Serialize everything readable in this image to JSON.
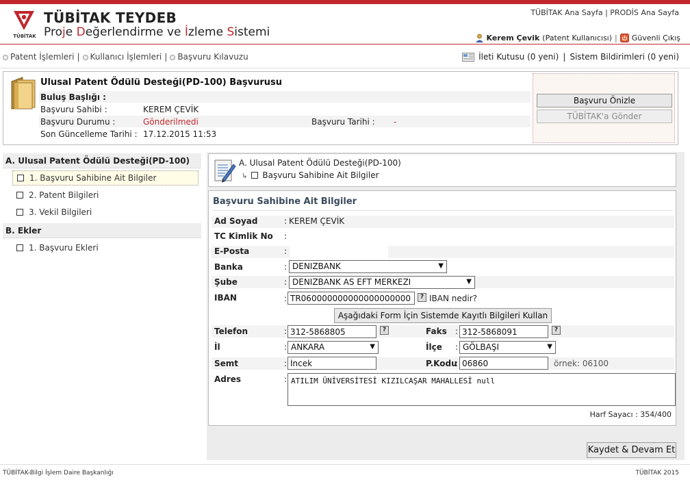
{
  "header": {
    "org_short": "TÜBİTAK",
    "app_name": "TÜBİTAK TEYDEB",
    "app_sub_parts": [
      "Pro",
      "j",
      "e ",
      "D",
      "eğerlendirme ve ",
      "İ",
      "zleme ",
      "S",
      "istemi"
    ],
    "top_link_home": "TÜBİTAK Ana Sayfa",
    "top_link_sep": "|",
    "top_link_prodis": "PRODİS Ana Sayfa",
    "user_name": "Kerem Çevik",
    "user_role": "(Patent Kullanıcısı)",
    "logout": "Güvenli Çıkış",
    "logo_icon": "tubitak-logo-icon",
    "user_icon": "user-icon",
    "logout_icon": "power-icon"
  },
  "nav": {
    "items": [
      "Patent İşlemleri",
      "Kullanıcı İşlemleri",
      "Başvuru Kılavuzu"
    ],
    "sep": "|",
    "inbox": "İleti Kutusu (0 yeni)",
    "system_notices": "Sistem Bildirimleri (0 yeni)"
  },
  "application": {
    "title": "Ulusal Patent Ödülü Desteği(PD-100) Başvurusu",
    "rows": {
      "invention_title_label": "Buluş Başlığı :",
      "invention_title_value": "",
      "owner_label": "Başvuru Sahibi :",
      "owner_value": "KEREM ÇEVİK",
      "status_label": "Başvuru Durumu :",
      "status_value": "Gönderilmedi",
      "date_label": "Başvuru Tarihi :",
      "date_value": "-",
      "updated_label": "Son Güncelleme Tarihi :",
      "updated_value": "17.12.2015 11:53"
    },
    "preview_button": "Başvuru Önizle",
    "send_button": "TÜBİTAK'a Gönder"
  },
  "sidebar": {
    "section_a": "A. Ulusal Patent Ödülü Desteği(PD-100)",
    "items_a": [
      "1. Başvuru Sahibine Ait Bilgiler",
      "2. Patent Bilgileri",
      "3. Vekil Bilgileri"
    ],
    "section_b": "B. Ekler",
    "items_b": [
      "1. Başvuru Ekleri"
    ]
  },
  "breadcrumb": {
    "level1": "A. Ulusal Patent Ödülü Desteği(PD-100)",
    "level2": "Başvuru Sahibine Ait Bilgiler"
  },
  "form": {
    "title": "Başvuru Sahibine Ait Bilgiler",
    "name_label": "Ad Soyad",
    "name_value": "KEREM ÇEVİK",
    "tc_label": "TC Kimlik No",
    "tc_value": "",
    "email_label": "E-Posta",
    "email_value": "",
    "bank_label": "Banka",
    "bank_value": "DENIZBANK",
    "branch_label": "Şube",
    "branch_value": "DENIZBANK AS EFT MERKEZI",
    "iban_label": "IBAN",
    "iban_value": "TR060000000000000000000",
    "iban_help": "IBAN nedir?",
    "use_saved_button": "Aşağıdaki Form İçin Sistemde Kayıtlı Bilgileri Kullan",
    "phone_label": "Telefon",
    "phone_value": "312-5868805",
    "fax_label": "Faks",
    "fax_value": "312-5868091",
    "city_label": "İl",
    "city_value": "ANKARA",
    "district_label": "İlçe",
    "district_value": "GÖLBAŞI",
    "area_label": "Semt",
    "area_value": "İncek",
    "postcode_label": "P.Kodu",
    "postcode_value": "06860",
    "postcode_example": "örnek: 06100",
    "address_label": "Adres",
    "address_value": "ATILIM ÜNİVERSİTESİ KIZILCAŞAR MAHALLESİ null",
    "char_counter": "Harf Sayacı : 354/400",
    "colon": ":",
    "help_glyph": "?"
  },
  "save_button": "Kaydet & Devam Et",
  "footer": {
    "left": "TÜBİTAK-Bilgi İşlem Daire Başkanlığı",
    "right": "TÜBİTAK 2015"
  },
  "colors": {
    "brand_red": "#c0272d",
    "status_red": "#c0272d",
    "panel_gray": "#ececec"
  }
}
